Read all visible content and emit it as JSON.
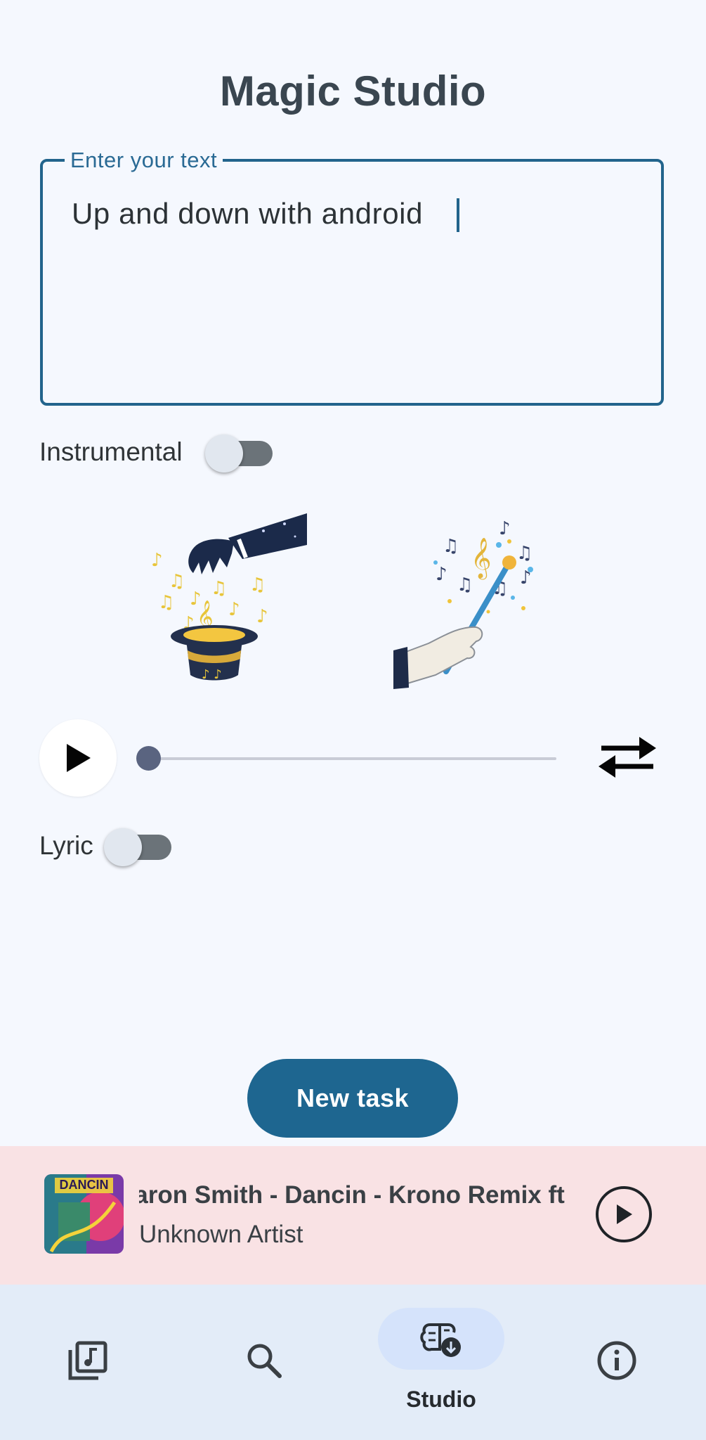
{
  "header": {
    "title": "Magic Studio"
  },
  "prompt_field": {
    "label": "Enter your text",
    "value": "Up and down with android"
  },
  "instrumental": {
    "label": "Instrumental",
    "on": false
  },
  "player": {
    "progress": 0,
    "play_icon": "play-icon",
    "swap_icon": "swap-arrows-icon"
  },
  "lyric": {
    "label": "Lyric",
    "on": false
  },
  "actions": {
    "new_task_label": "New task"
  },
  "mini_player": {
    "title": "Aaron Smith - Dancin - Krono Remix ft",
    "artist": "Unknown Artist",
    "album_text": "DANCIN"
  },
  "bottom_nav": {
    "items": [
      {
        "icon": "library-music-icon",
        "label": ""
      },
      {
        "icon": "search-icon",
        "label": ""
      },
      {
        "icon": "studio-brain-icon",
        "label": "Studio",
        "selected": true
      },
      {
        "icon": "info-icon",
        "label": ""
      }
    ]
  },
  "colors": {
    "accent": "#1e6690",
    "background": "#f5f8fe",
    "mini_player_bg": "#f9e2e4",
    "nav_bg": "#e3ecf8"
  }
}
